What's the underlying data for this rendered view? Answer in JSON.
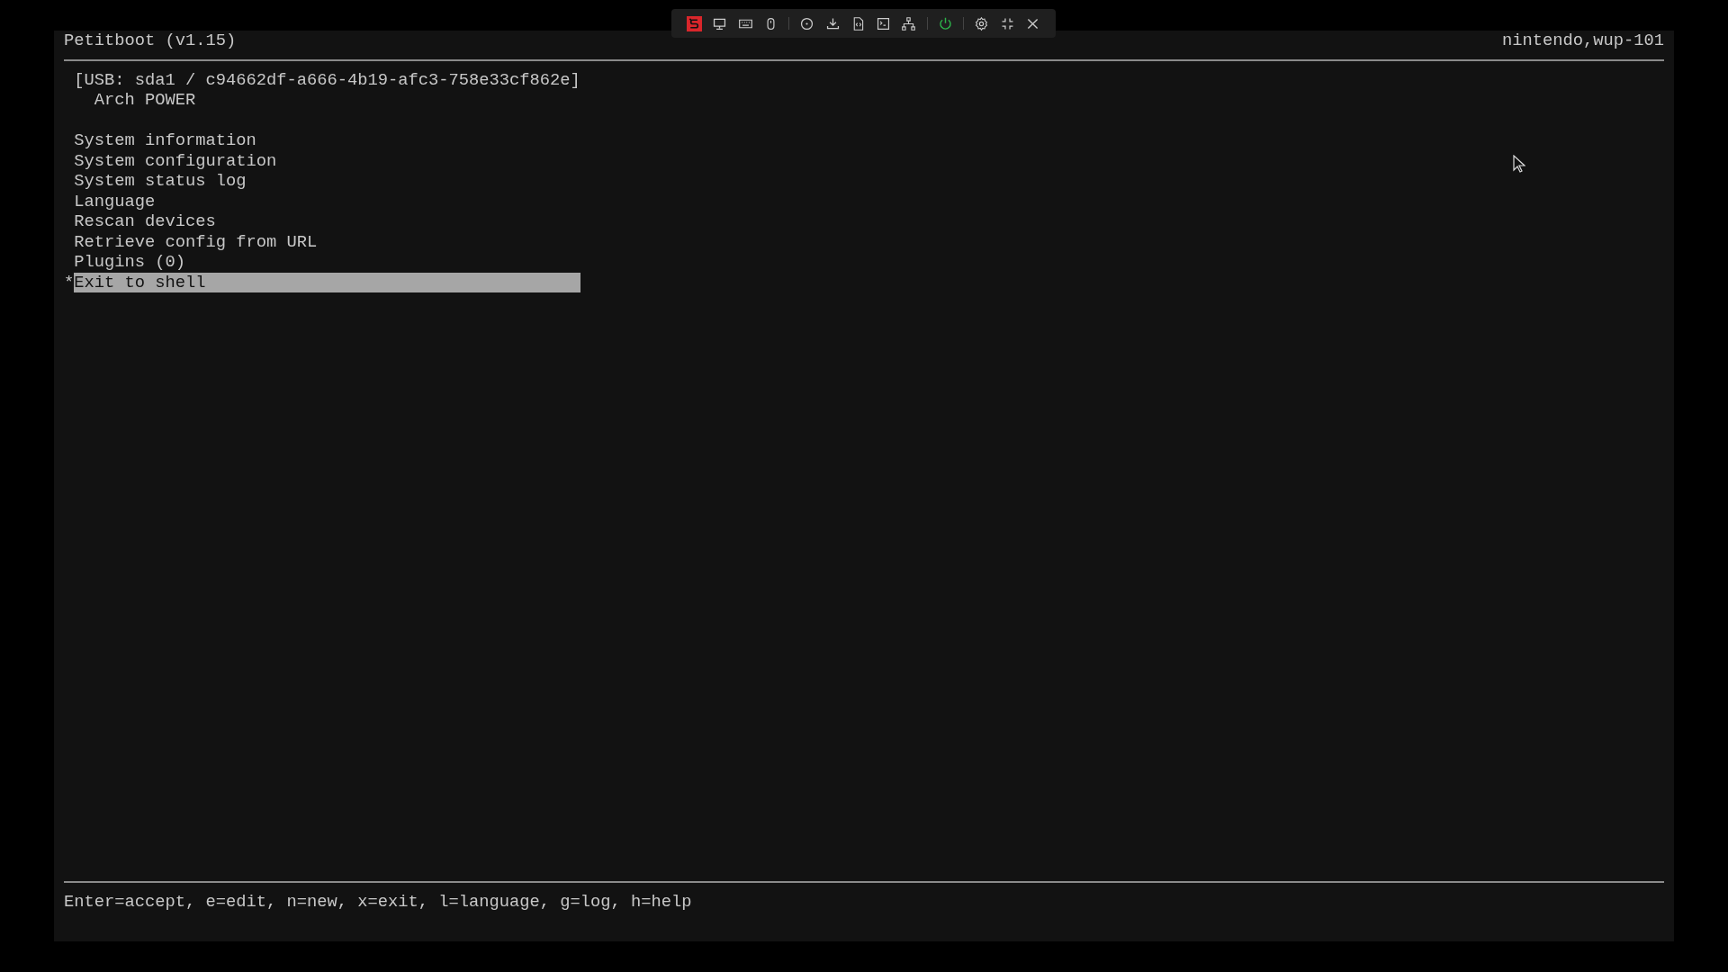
{
  "header": {
    "title": "Petitboot (v1.15)",
    "machine": "nintendo,wup-101"
  },
  "cursor_marker": "*",
  "boot_device": {
    "label": "[USB: sda1 / c94662df-a666-4b19-afc3-758e33cf862e]",
    "options": [
      {
        "label": "Arch POWER",
        "selected": false
      }
    ]
  },
  "menu": [
    {
      "label": "System information",
      "selected": false
    },
    {
      "label": "System configuration",
      "selected": false
    },
    {
      "label": "System status log",
      "selected": false
    },
    {
      "label": "Language",
      "selected": false
    },
    {
      "label": "Rescan devices",
      "selected": false
    },
    {
      "label": "Retrieve config from URL",
      "selected": false
    },
    {
      "label": "Plugins (0)",
      "selected": false
    },
    {
      "label": "Exit to shell",
      "selected": true
    }
  ],
  "status_bar": "Enter=accept, e=edit, n=new, x=exit, l=language, g=log, h=help"
}
